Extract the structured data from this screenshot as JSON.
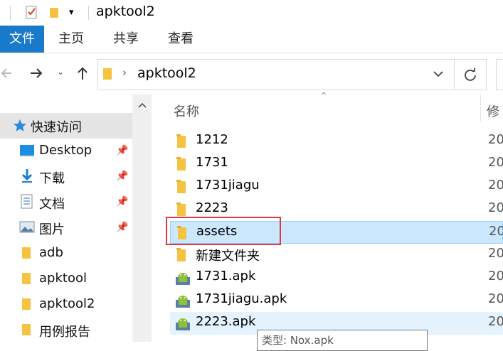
{
  "window": {
    "title": "apktool2"
  },
  "ribbon": {
    "tabs": [
      "文件",
      "主页",
      "共享",
      "查看"
    ]
  },
  "address": {
    "path": "apktool2"
  },
  "nav": {
    "quick_access": "快速访问",
    "items": [
      {
        "label": "Desktop",
        "pinned": true
      },
      {
        "label": "下载",
        "pinned": true
      },
      {
        "label": "文档",
        "pinned": true
      },
      {
        "label": "图片",
        "pinned": true
      },
      {
        "label": "adb",
        "pinned": false
      },
      {
        "label": "apktool",
        "pinned": false
      },
      {
        "label": "apktool2",
        "pinned": false
      },
      {
        "label": "用例报告",
        "pinned": false
      }
    ]
  },
  "columns": {
    "name": "名称",
    "modified": "修"
  },
  "files": [
    {
      "name": "1212",
      "type": "folder",
      "date": "20"
    },
    {
      "name": "1731",
      "type": "folder",
      "date": "20"
    },
    {
      "name": "1731jiagu",
      "type": "folder",
      "date": "20"
    },
    {
      "name": "2223",
      "type": "folder",
      "date": "20"
    },
    {
      "name": "assets",
      "type": "folder",
      "date": "20",
      "selected": true
    },
    {
      "name": "新建文件夹",
      "type": "folder",
      "date": "20"
    },
    {
      "name": "1731.apk",
      "type": "apk",
      "date": "20"
    },
    {
      "name": "1731jiagu.apk",
      "type": "apk",
      "date": "20"
    },
    {
      "name": "2223.apk",
      "type": "apk",
      "date": "20",
      "hovered": true
    }
  ],
  "tooltip": {
    "text": "类型: Nox.apk"
  },
  "colors": {
    "accent": "#1979ca",
    "selection": "#cce8ff",
    "hover": "#e5f3ff",
    "highlight_border": "#e0393e"
  }
}
